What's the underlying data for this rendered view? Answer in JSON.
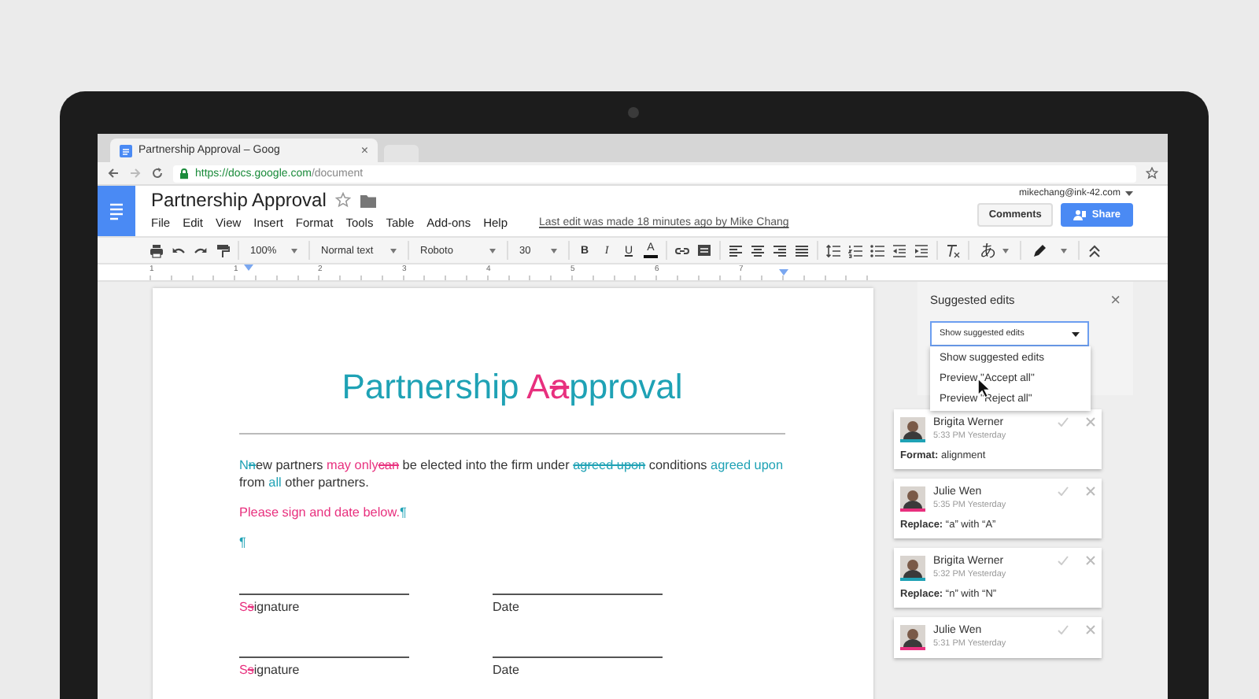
{
  "browser": {
    "tab": {
      "title": "Partnership Approval – Goog",
      "close": "×"
    },
    "url": {
      "host": "https://docs.google.com",
      "path": "/document"
    }
  },
  "docs_header": {
    "title": "Partnership Approval",
    "menu": [
      "File",
      "Edit",
      "View",
      "Insert",
      "Format",
      "Tools",
      "Table",
      "Add-ons",
      "Help"
    ],
    "last_edit": "Last edit was made 18 minutes ago by Mike Chang",
    "account": "mikechang@ink-42.com",
    "buttons": {
      "comments": "Comments",
      "share": "Share"
    }
  },
  "toolbar": {
    "zoom": "100%",
    "style": "Normal text",
    "font": "Roboto",
    "size": "30",
    "bold": "B",
    "italic": "I",
    "underline": "U",
    "text_color": "A",
    "input_tools": "あ"
  },
  "ruler": [
    "1",
    "1",
    "2",
    "3",
    "4",
    "5",
    "6",
    "7"
  ],
  "document": {
    "title_runs": [
      {
        "text": "Partnership ",
        "kind": "plain_accent",
        "color": "#1fa2b5"
      },
      {
        "text": "A",
        "kind": "insert",
        "color": "#e8307e"
      },
      {
        "text": "a",
        "kind": "delete",
        "color": "#e8307e"
      },
      {
        "text": "pproval",
        "kind": "plain_accent",
        "color": "#1fa2b5"
      }
    ],
    "paragraphs": [
      {
        "runs": [
          {
            "text": "N",
            "kind": "insert",
            "color": "#1fa2b5"
          },
          {
            "text": "n",
            "kind": "delete",
            "color": "#1fa2b5"
          },
          {
            "text": "ew partners ",
            "kind": "plain"
          },
          {
            "text": "may only",
            "kind": "insert",
            "color": "#e8307e"
          },
          {
            "text": "can",
            "kind": "delete",
            "color": "#e8307e"
          },
          {
            "text": " be elected into the firm under ",
            "kind": "plain"
          },
          {
            "text": "agreed upon",
            "kind": "delete",
            "color": "#1fa2b5"
          },
          {
            "text": " conditions ",
            "kind": "plain"
          },
          {
            "text": "agreed upon",
            "kind": "insert",
            "color": "#1fa2b5"
          },
          {
            "text": " from ",
            "kind": "plain"
          },
          {
            "text": "all",
            "kind": "insert",
            "color": "#1fa2b5"
          },
          {
            "text": " other partners.",
            "kind": "plain"
          }
        ]
      },
      {
        "runs": [
          {
            "text": "Please sign and date below.",
            "kind": "insert",
            "color": "#e8307e"
          },
          {
            "text": "¶",
            "kind": "insert",
            "color": "#1fa2b5"
          }
        ]
      },
      {
        "runs": [
          {
            "text": "¶",
            "kind": "insert",
            "color": "#1fa2b5"
          }
        ]
      }
    ],
    "signature_rows": [
      {
        "fields": [
          {
            "runs": [
              {
                "text": "S",
                "kind": "insert",
                "color": "#e8307e"
              },
              {
                "text": "s",
                "kind": "delete",
                "color": "#e8307e"
              },
              {
                "text": "ignature",
                "kind": "plain"
              }
            ]
          },
          {
            "runs": [
              {
                "text": "Date",
                "kind": "plain"
              }
            ]
          }
        ]
      },
      {
        "fields": [
          {
            "runs": [
              {
                "text": "S",
                "kind": "insert",
                "color": "#e8307e"
              },
              {
                "text": "s",
                "kind": "delete",
                "color": "#e8307e"
              },
              {
                "text": "ignature",
                "kind": "plain"
              }
            ]
          },
          {
            "runs": [
              {
                "text": "Date",
                "kind": "plain"
              }
            ]
          }
        ]
      }
    ]
  },
  "suggested_edits": {
    "title": "Suggested edits",
    "close": "×",
    "select": "Show suggested edits",
    "options": [
      "Show suggested edits",
      "Preview \"Accept all\"",
      "Preview \"Reject all\""
    ],
    "cards": [
      {
        "author": "Brigita Werner",
        "time": "5:33 PM Yesterday",
        "action": "Format:",
        "detail": "alignment",
        "color": "#1fa2b5"
      },
      {
        "author": "Julie Wen",
        "time": "5:35 PM Yesterday",
        "action": "Replace:",
        "detail": "“a” with “A”",
        "color": "#e8307e"
      },
      {
        "author": "Brigita Werner",
        "time": "5:32 PM Yesterday",
        "action": "Replace:",
        "detail": "“n” with “N”",
        "color": "#1fa2b5"
      },
      {
        "author": "Julie Wen",
        "time": "5:31 PM Yesterday",
        "color": "#e8307e"
      }
    ]
  }
}
